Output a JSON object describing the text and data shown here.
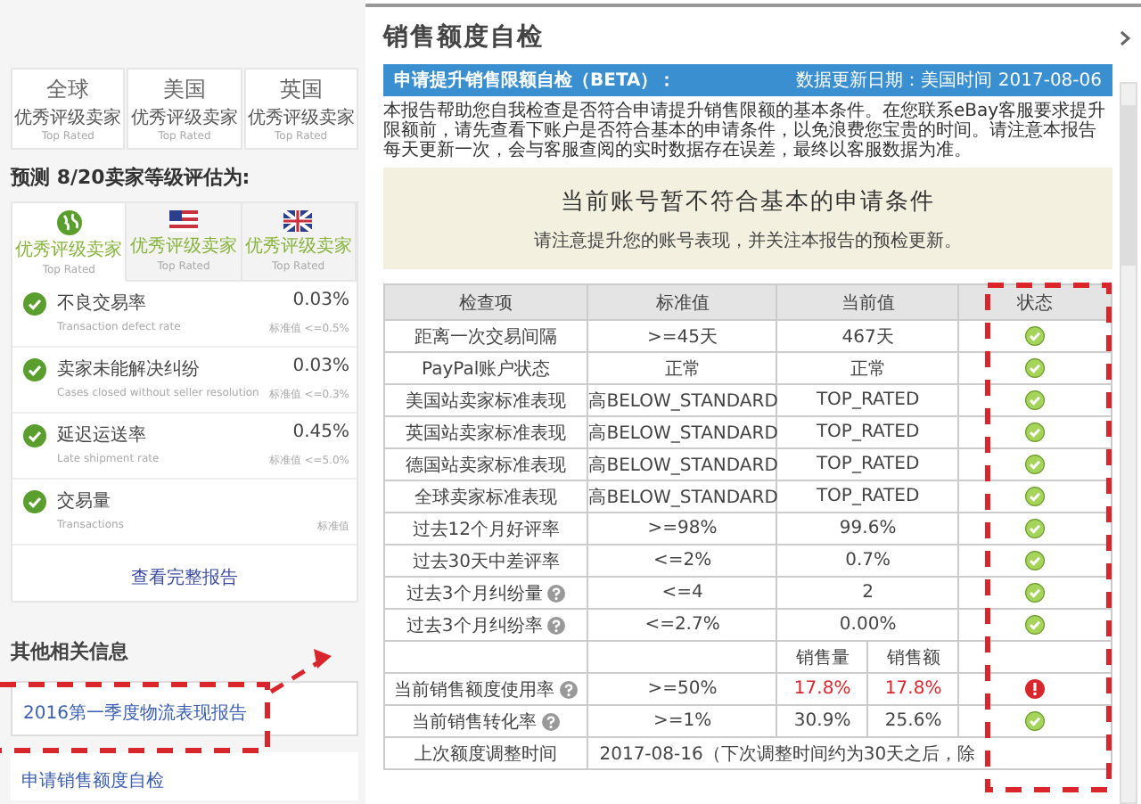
{
  "left": {
    "regions": [
      {
        "name": "全球",
        "rating": "优秀评级卖家",
        "rating_en": "Top Rated"
      },
      {
        "name": "美国",
        "rating": "优秀评级卖家",
        "rating_en": "Top Rated"
      },
      {
        "name": "英国",
        "rating": "优秀评级卖家",
        "rating_en": "Top Rated"
      }
    ],
    "forecast_title": "预测 8/20卖家等级评估为:",
    "forecast_tabs": [
      {
        "kind": "globe",
        "rating": "优秀评级卖家",
        "rating_en": "Top Rated",
        "selected": true
      },
      {
        "kind": "us",
        "rating": "优秀评级卖家",
        "rating_en": "Top Rated",
        "selected": false
      },
      {
        "kind": "uk",
        "rating": "优秀评级卖家",
        "rating_en": "Top Rated",
        "selected": false
      }
    ],
    "metrics": [
      {
        "name": "不良交易率",
        "name_en": "Transaction defect rate",
        "value": "0.03%",
        "standard": "标准值 <=0.5%"
      },
      {
        "name": "卖家未能解决纠纷",
        "name_en": "Cases closed without seller resolution",
        "value": "0.03%",
        "standard": "标准值 <=0.3%"
      },
      {
        "name": "延迟运送率",
        "name_en": "Late shipment rate",
        "value": "0.45%",
        "standard": "标准值 <=5.0%"
      },
      {
        "name": "交易量",
        "name_en": "Transactions",
        "standard": "标准值"
      }
    ],
    "full_report": "查看完整报告",
    "other_title": "其他相关信息",
    "other_link": "2016第一季度物流表现报告",
    "apply_link": "申请销售额度自检"
  },
  "dialog": {
    "title": "销售额度自检",
    "header": {
      "title": "申请提升销售限额自检（BETA）：",
      "date": "数据更新日期：美国时间 2017-08-06"
    },
    "intro": "本报告帮助您自我检查是否符合申请提升销售限额的基本条件。在您联系eBay客服要求提升限额前，请先查看下账户是否符合基本的申请条件，以免浪费您宝贵的时间。请注意本报告每天更新一次，会与客服查阅的实时数据存在误差，最终以客服数据为准。",
    "notice": {
      "title": "当前账号暂不符合基本的申请条件",
      "subtitle": "请注意提升您的账号表现，并关注本报告的预检更新。"
    },
    "columns": [
      "检查项",
      "标准值",
      "当前值",
      "状态"
    ],
    "rows": [
      {
        "kind": "single",
        "item": "距离一次交易间隔",
        "help": false,
        "standard": ">=45天",
        "current": "467天",
        "ok": true
      },
      {
        "kind": "single",
        "item": "PayPal账户状态",
        "help": false,
        "standard": "正常",
        "current": "正常",
        "ok": true
      },
      {
        "kind": "single",
        "item": "美国站卖家标准表现",
        "help": false,
        "standard": "高BELOW_STANDARD",
        "current": "TOP_RATED",
        "ok": true
      },
      {
        "kind": "single",
        "item": "英国站卖家标准表现",
        "help": false,
        "standard": "高BELOW_STANDARD",
        "current": "TOP_RATED",
        "ok": true
      },
      {
        "kind": "single",
        "item": "德国站卖家标准表现",
        "help": false,
        "standard": "高BELOW_STANDARD",
        "current": "TOP_RATED",
        "ok": true
      },
      {
        "kind": "single",
        "item": "全球卖家标准表现",
        "help": false,
        "standard": "高BELOW_STANDARD",
        "current": "TOP_RATED",
        "ok": true
      },
      {
        "kind": "single",
        "item": "过去12个月好评率",
        "help": false,
        "standard": ">=98%",
        "current": "99.6%",
        "ok": true
      },
      {
        "kind": "single",
        "item": "过去30天中差评率",
        "help": false,
        "standard": "<=2%",
        "current": "0.7%",
        "ok": true
      },
      {
        "kind": "single",
        "item": "过去3个月纠纷量",
        "help": true,
        "standard": "<=4",
        "current": "2",
        "ok": true
      },
      {
        "kind": "single",
        "item": "过去3个月纠纷率",
        "help": true,
        "standard": "<=2.7%",
        "current": "0.00%",
        "ok": true
      },
      {
        "kind": "subheader",
        "cells": [
          "销售量",
          "销售额"
        ]
      },
      {
        "kind": "split",
        "item": "当前销售额度使用率",
        "help": true,
        "standard": ">=50%",
        "cells": [
          "17.8%",
          "17.8%"
        ],
        "ok": false
      },
      {
        "kind": "split",
        "item": "当前销售转化率",
        "help": true,
        "standard": ">=1%",
        "cells": [
          "30.9%",
          "25.6%"
        ],
        "ok": true
      },
      {
        "kind": "note",
        "item": "上次额度调整时间",
        "text": "2017-08-16（下次调整时间约为30天之后，除"
      }
    ]
  }
}
